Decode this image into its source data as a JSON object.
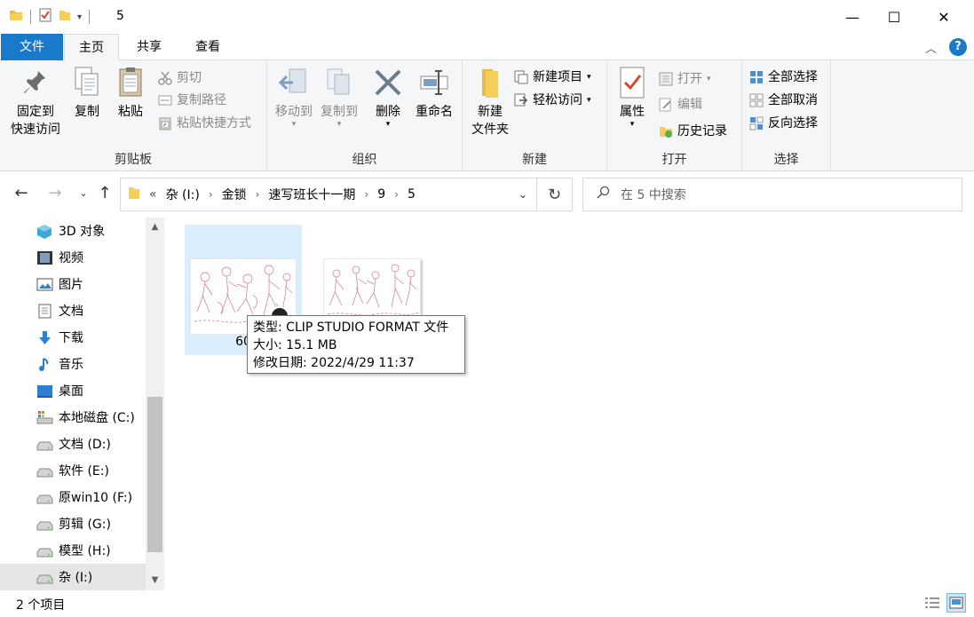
{
  "window": {
    "title": "5",
    "minimize": "—",
    "maximize": "☐",
    "close": "✕"
  },
  "ribbon_tabs": {
    "file": "文件",
    "home": "主页",
    "share": "共享",
    "view": "查看"
  },
  "clipboard": {
    "pin_line1": "固定到",
    "pin_line2": "快速访问",
    "copy": "复制",
    "paste": "粘贴",
    "cut": "剪切",
    "copy_path": "复制路径",
    "paste_shortcut": "粘贴快捷方式",
    "label": "剪贴板"
  },
  "organize": {
    "move_to": "移动到",
    "copy_to": "复制到",
    "delete": "删除",
    "rename": "重命名",
    "label": "组织"
  },
  "new": {
    "new_folder_line1": "新建",
    "new_folder_line2": "文件夹",
    "new_item": "新建项目",
    "easy_access": "轻松访问",
    "label": "新建"
  },
  "open": {
    "properties": "属性",
    "open": "打开",
    "edit": "编辑",
    "history": "历史记录",
    "label": "打开"
  },
  "select": {
    "select_all": "全部选择",
    "select_none": "全部取消",
    "invert": "反向选择",
    "label": "选择"
  },
  "address": {
    "overflow": "«",
    "crumbs": [
      "杂 (I:)",
      "金锁",
      "速写班长十一期",
      "9",
      "5"
    ]
  },
  "search": {
    "placeholder": "在 5 中搜索"
  },
  "nav_pane": {
    "items": [
      {
        "label": "3D 对象",
        "icon": "3d-objects-icon"
      },
      {
        "label": "视频",
        "icon": "video-icon"
      },
      {
        "label": "图片",
        "icon": "pictures-icon"
      },
      {
        "label": "文档",
        "icon": "documents-icon"
      },
      {
        "label": "下载",
        "icon": "download-icon"
      },
      {
        "label": "音乐",
        "icon": "music-icon"
      },
      {
        "label": "桌面",
        "icon": "desktop-icon"
      },
      {
        "label": "本地磁盘 (C:)",
        "icon": "system-drive-icon"
      },
      {
        "label": "文档 (D:)",
        "icon": "drive-icon"
      },
      {
        "label": "软件 (E:)",
        "icon": "drive-icon"
      },
      {
        "label": "原win10 (F:)",
        "icon": "drive-icon"
      },
      {
        "label": "剪辑 (G:)",
        "icon": "drive-icon"
      },
      {
        "label": "模型 (H:)",
        "icon": "drive-icon"
      },
      {
        "label": "杂 (I:)",
        "icon": "drive-icon"
      }
    ]
  },
  "files": [
    {
      "name": "60",
      "selected": true
    },
    {
      "name": "",
      "selected": false
    }
  ],
  "tooltip": {
    "type": "类型: CLIP STUDIO FORMAT 文件",
    "size": "大小: 15.1 MB",
    "modified": "修改日期: 2022/4/29 11:37"
  },
  "status": {
    "count": "2 个项目"
  },
  "colors": {
    "accent": "#1979ca",
    "ribbon_bg": "#f5f6f7",
    "selection": "#dbeefd"
  }
}
